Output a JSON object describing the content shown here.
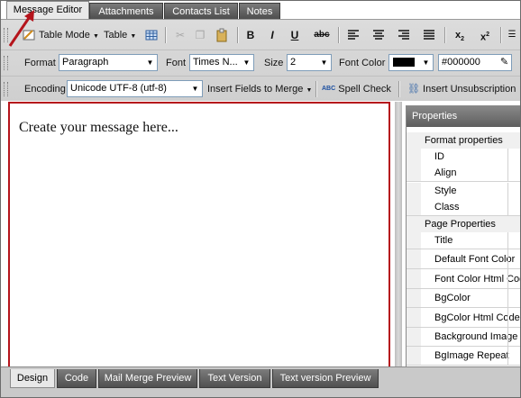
{
  "tabs": [
    "Message Editor",
    "Attachments",
    "Contacts List",
    "Notes"
  ],
  "toolbar1": {
    "table_mode": "Table Mode",
    "table": "Table",
    "bold": "B",
    "italic": "I",
    "underline": "U",
    "strike": "abc",
    "subscript": "x",
    "superscript": "x",
    "subscript_mark": "2",
    "superscript_mark": "2"
  },
  "toolbar2": {
    "format_label": "Format",
    "format_value": "Paragraph",
    "font_label": "Font",
    "font_value": "Times N...",
    "size_label": "Size",
    "size_value": "2",
    "font_color_label": "Font Color",
    "color_hex": "#000000",
    "color_swatch": "#000000"
  },
  "toolbar3": {
    "encoding_label": "Encoding",
    "encoding_value": "Unicode UTF-8 (utf-8)",
    "insert_fields": "Insert Fields to Merge",
    "spell_check": "Spell Check",
    "spell_icon_text": "ABC",
    "insert_unsubscription": "Insert Unsubscription"
  },
  "editor": {
    "placeholder_text": "Create your message here..."
  },
  "properties": {
    "title": "Properties",
    "format_category": "Format properties",
    "format_items": [
      "ID",
      "Align",
      "Style",
      "Class"
    ],
    "page_category": "Page Properties",
    "page_items": [
      "Title",
      "Default Font Color",
      "Font Color Html Code",
      "BgColor",
      "BgColor Html Code",
      "Background Image",
      "BgImage Repeat"
    ]
  },
  "bottom_tabs": [
    "Design",
    "Code",
    "Mail Merge Preview",
    "Text Version",
    "Text version Preview"
  ],
  "colors": {
    "highlight": "#b5141c",
    "tab_dark": "#5e5e5e"
  }
}
